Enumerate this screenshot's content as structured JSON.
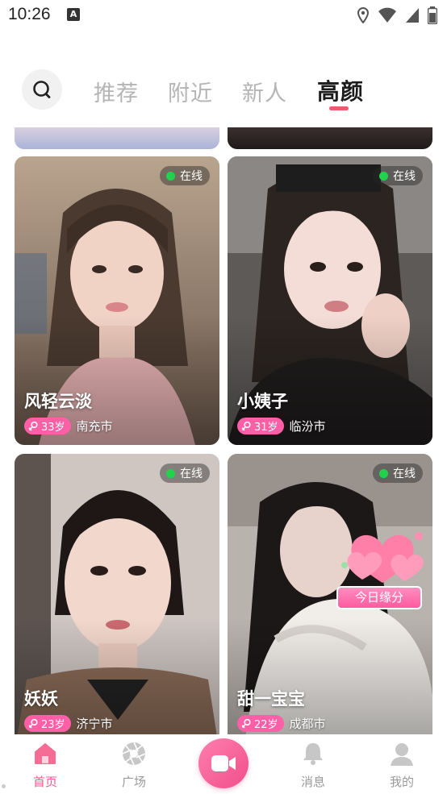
{
  "status_bar": {
    "time": "10:26",
    "notification_glyph": "A"
  },
  "tabs": [
    {
      "label": "推荐",
      "active": false
    },
    {
      "label": "附近",
      "active": false
    },
    {
      "label": "新人",
      "active": false
    },
    {
      "label": "高颜",
      "active": true
    }
  ],
  "cards": [
    {
      "name": "风轻云淡",
      "online_label": "在线",
      "age": "33岁",
      "city": "南充市"
    },
    {
      "name": "小姨子",
      "online_label": "在线",
      "age": "31岁",
      "city": "临汾市"
    },
    {
      "name": "妖妖",
      "online_label": "在线",
      "age": "23岁",
      "city": "济宁市"
    },
    {
      "name": "甜一宝宝",
      "online_label": "在线",
      "age": "22岁",
      "city": "成都市"
    }
  ],
  "promo": {
    "label": "今日缘分"
  },
  "bottom_nav": [
    {
      "label": "首页",
      "icon": "home-icon",
      "active": true
    },
    {
      "label": "广场",
      "icon": "aperture-icon",
      "active": false
    },
    {
      "label": "",
      "icon": "video-camera-icon",
      "active": false
    },
    {
      "label": "消息",
      "icon": "bell-icon",
      "active": false
    },
    {
      "label": "我的",
      "icon": "profile-icon",
      "active": false
    }
  ],
  "colors": {
    "accent": "#ef5b6e",
    "age_badge": "#ff5fa6",
    "online_dot": "#21d34c"
  }
}
